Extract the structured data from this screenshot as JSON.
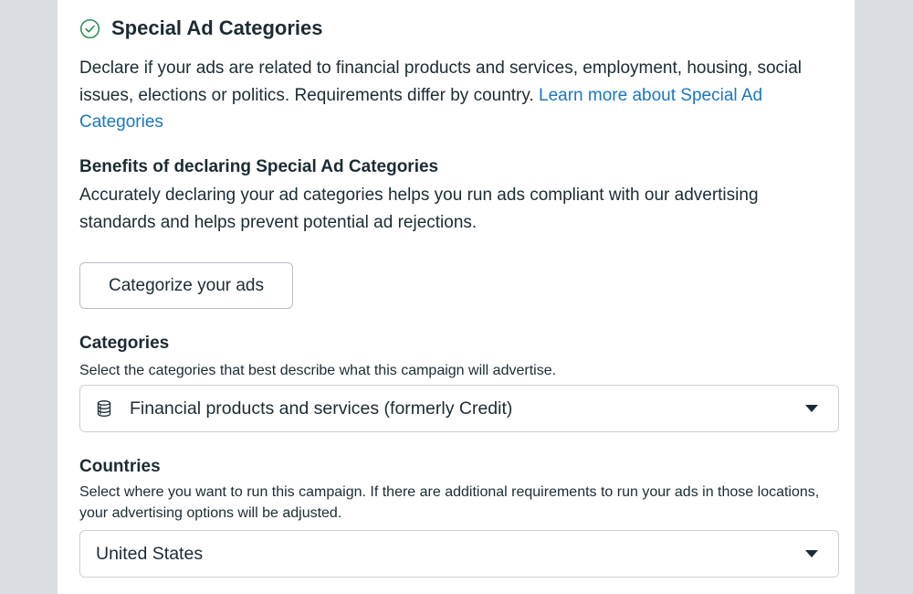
{
  "header": {
    "title": "Special Ad Categories",
    "icon": "check-circle-icon"
  },
  "intro": {
    "text": "Declare if your ads are related to financial products and services, employment, housing, social issues, elections or politics. Requirements differ by country. ",
    "link": "Learn more about Special Ad Categories"
  },
  "benefits": {
    "title": "Benefits of declaring Special Ad Categories",
    "text": "Accurately declaring your ad categories helps you run ads compliant with our advertising standards and helps prevent potential ad rejections."
  },
  "categorize_button": {
    "label": "Categorize your ads"
  },
  "categories": {
    "title": "Categories",
    "description": "Select the categories that best describe what this campaign will advertise.",
    "selected": "Financial products and services (formerly Credit)",
    "icon": "coin-stack-icon"
  },
  "countries": {
    "title": "Countries",
    "description": "Select where you want to run this campaign. If there are additional requirements to run your ads in those locations, your advertising options will be adjusted.",
    "selected": "United States"
  },
  "colors": {
    "link": "#1877c2",
    "check": "#2e8b57",
    "text": "#1c2b33",
    "background": "#dadde1"
  }
}
